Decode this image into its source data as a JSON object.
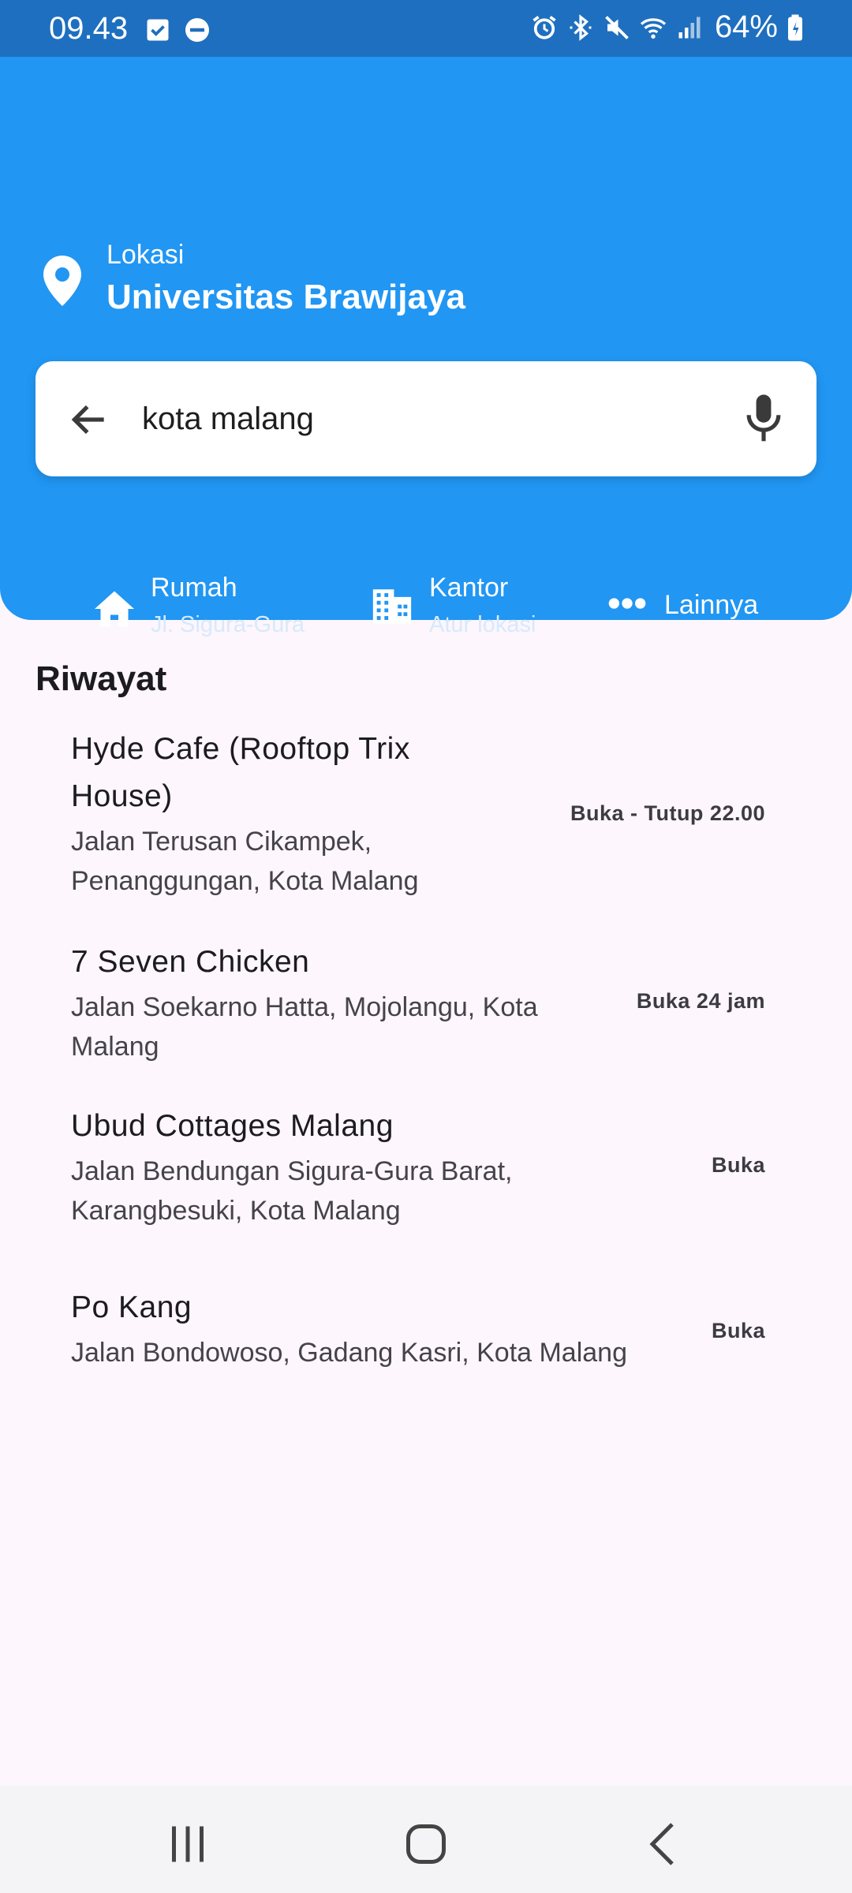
{
  "status_bar": {
    "time": "09.43",
    "battery": "64%",
    "left_icons": [
      "checkbox-icon",
      "do-not-disturb-icon"
    ],
    "right_icons": [
      "alarm-icon",
      "bluetooth-icon",
      "mute-icon",
      "wifi-icon",
      "signal-icon",
      "battery-icon"
    ]
  },
  "location": {
    "label": "Lokasi",
    "value": "Universitas Brawijaya"
  },
  "search": {
    "value": "kota malang"
  },
  "shortcuts": {
    "home": {
      "title": "Rumah",
      "subtitle": "Jl. Sigura-Gura"
    },
    "office": {
      "title": "Kantor",
      "subtitle": "Atur lokasi"
    },
    "more": {
      "title": "Lainnya"
    }
  },
  "history": {
    "title": "Riwayat",
    "items": [
      {
        "name": "Hyde Cafe (Rooftop Trix House)",
        "address": "Jalan Terusan Cikampek, Penanggungan, Kota Malang",
        "status": "Buka - Tutup 22.00"
      },
      {
        "name": "7 Seven Chicken",
        "address": "Jalan Soekarno Hatta, Mojolangu, Kota Malang",
        "status": "Buka 24 jam"
      },
      {
        "name": "Ubud Cottages Malang",
        "address": "Jalan Bendungan Sigura-Gura Barat, Karangbesuki, Kota Malang",
        "status": "Buka"
      },
      {
        "name": "Po Kang",
        "address": "Jalan Bondowoso, Gadang Kasri, Kota Malang",
        "status": "Buka"
      }
    ]
  },
  "colors": {
    "primary": "#2196f3",
    "status_bar": "#1e6fbf",
    "background": "#fdf6fc"
  }
}
